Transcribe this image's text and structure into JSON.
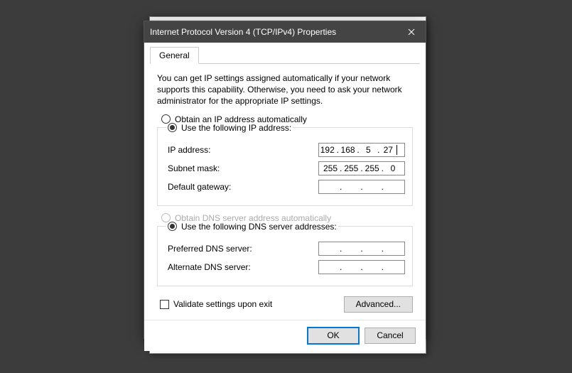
{
  "window": {
    "title": "Internet Protocol Version 4 (TCP/IPv4) Properties"
  },
  "tabs": {
    "general": "General"
  },
  "intro": "You can get IP settings assigned automatically if your network supports this capability. Otherwise, you need to ask your network administrator for the appropriate IP settings.",
  "ip": {
    "radio_auto": "Obtain an IP address automatically",
    "radio_manual": "Use the following IP address:",
    "selected": "manual",
    "labels": {
      "address": "IP address:",
      "subnet": "Subnet mask:",
      "gateway": "Default gateway:"
    },
    "address": {
      "o1": "192",
      "o2": "168",
      "o3": "5",
      "o4": "27"
    },
    "subnet": {
      "o1": "255",
      "o2": "255",
      "o3": "255",
      "o4": "0"
    },
    "gateway": {
      "o1": "",
      "o2": "",
      "o3": "",
      "o4": ""
    }
  },
  "dns": {
    "radio_auto": "Obtain DNS server address automatically",
    "radio_manual": "Use the following DNS server addresses:",
    "auto_enabled": false,
    "selected": "manual",
    "labels": {
      "preferred": "Preferred DNS server:",
      "alternate": "Alternate DNS server:"
    },
    "preferred": {
      "o1": "",
      "o2": "",
      "o3": "",
      "o4": ""
    },
    "alternate": {
      "o1": "",
      "o2": "",
      "o3": "",
      "o4": ""
    }
  },
  "validate": {
    "label": "Validate settings upon exit",
    "checked": false
  },
  "buttons": {
    "advanced": "Advanced...",
    "ok": "OK",
    "cancel": "Cancel"
  }
}
